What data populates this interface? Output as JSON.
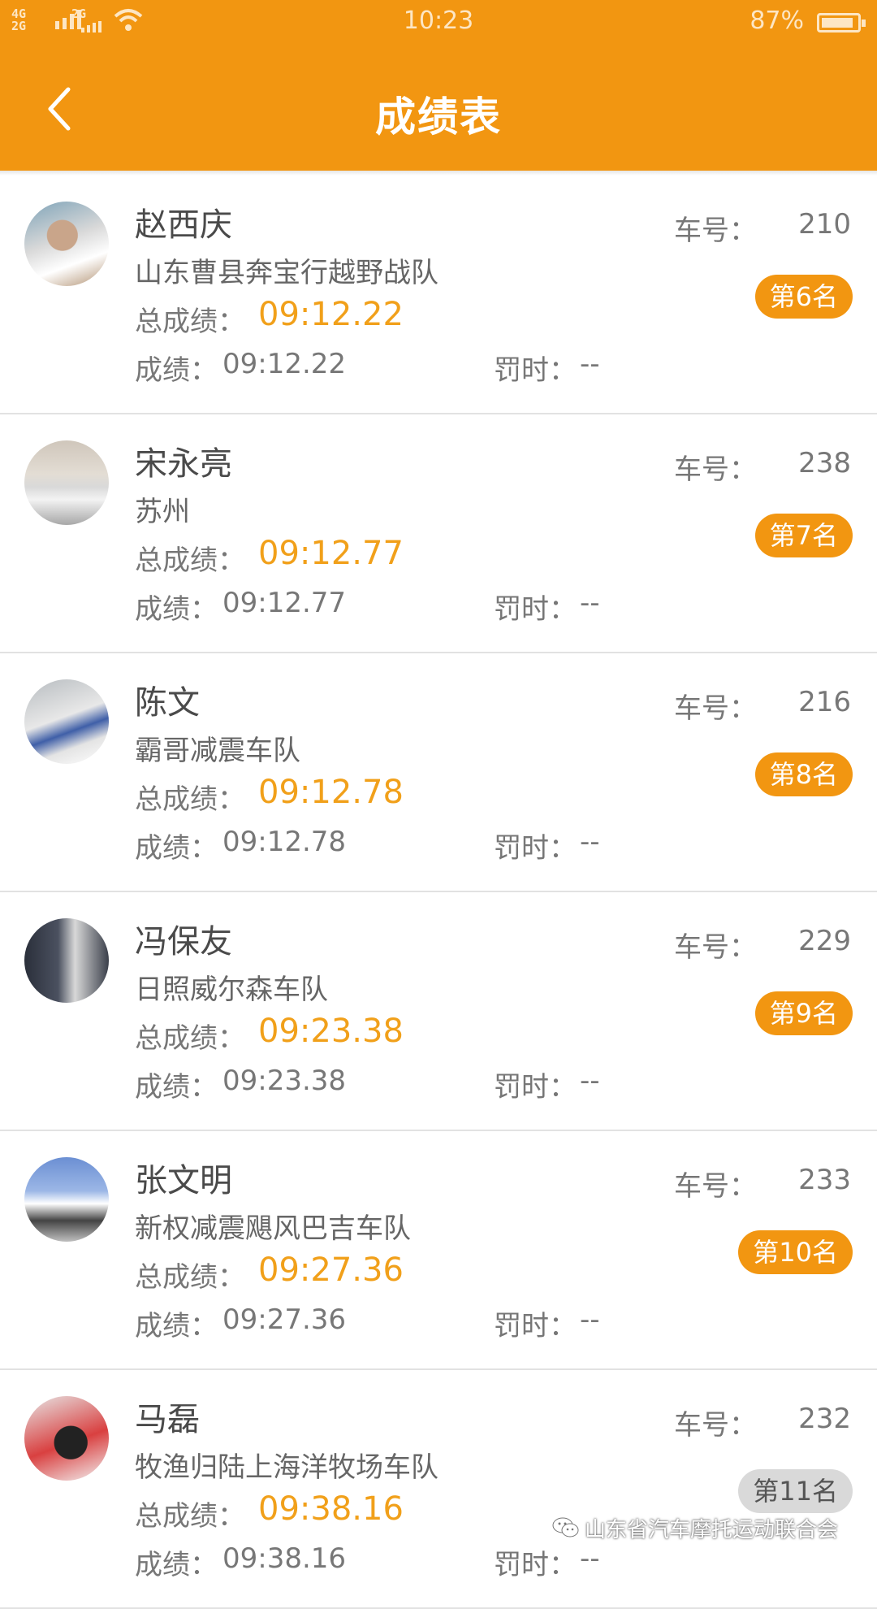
{
  "status_bar": {
    "net1": "4G",
    "net2": "2G",
    "net3": "2G",
    "time": "10:23",
    "battery": "87%",
    "battery_level": 0.87
  },
  "header": {
    "title": "成绩表",
    "back_icon": "chevron-left-icon"
  },
  "labels": {
    "car": "车号：",
    "total": "总成绩：",
    "score": "成绩：",
    "penalty": "罚时："
  },
  "colors": {
    "accent": "#f29611",
    "time_highlight": "#f1a01a"
  },
  "results": [
    {
      "name": "赵西庆",
      "team": "山东曹县奔宝行越野战队",
      "car_no": "210",
      "rank": "第6名",
      "total": "09:12.22",
      "score": "09:12.22",
      "penalty": "--"
    },
    {
      "name": "宋永亮",
      "team": "苏州",
      "car_no": "238",
      "rank": "第7名",
      "total": "09:12.77",
      "score": "09:12.77",
      "penalty": "--"
    },
    {
      "name": "陈文",
      "team": "霸哥减震车队",
      "car_no": "216",
      "rank": "第8名",
      "total": "09:12.78",
      "score": "09:12.78",
      "penalty": "--"
    },
    {
      "name": "冯保友",
      "team": "日照威尔森车队",
      "car_no": "229",
      "rank": "第9名",
      "total": "09:23.38",
      "score": "09:23.38",
      "penalty": "--"
    },
    {
      "name": "张文明",
      "team": "新权减震飓风巴吉车队",
      "car_no": "233",
      "rank": "第10名",
      "total": "09:27.36",
      "score": "09:27.36",
      "penalty": "--"
    },
    {
      "name": "马磊",
      "team": "牧渔归陆上海洋牧场车队",
      "car_no": "232",
      "rank": "第11名",
      "total": "09:38.16",
      "score": "09:38.16",
      "penalty": "--"
    }
  ],
  "watermark": {
    "text": "山东省汽车摩托运动联合会",
    "icon": "wechat-icon"
  }
}
